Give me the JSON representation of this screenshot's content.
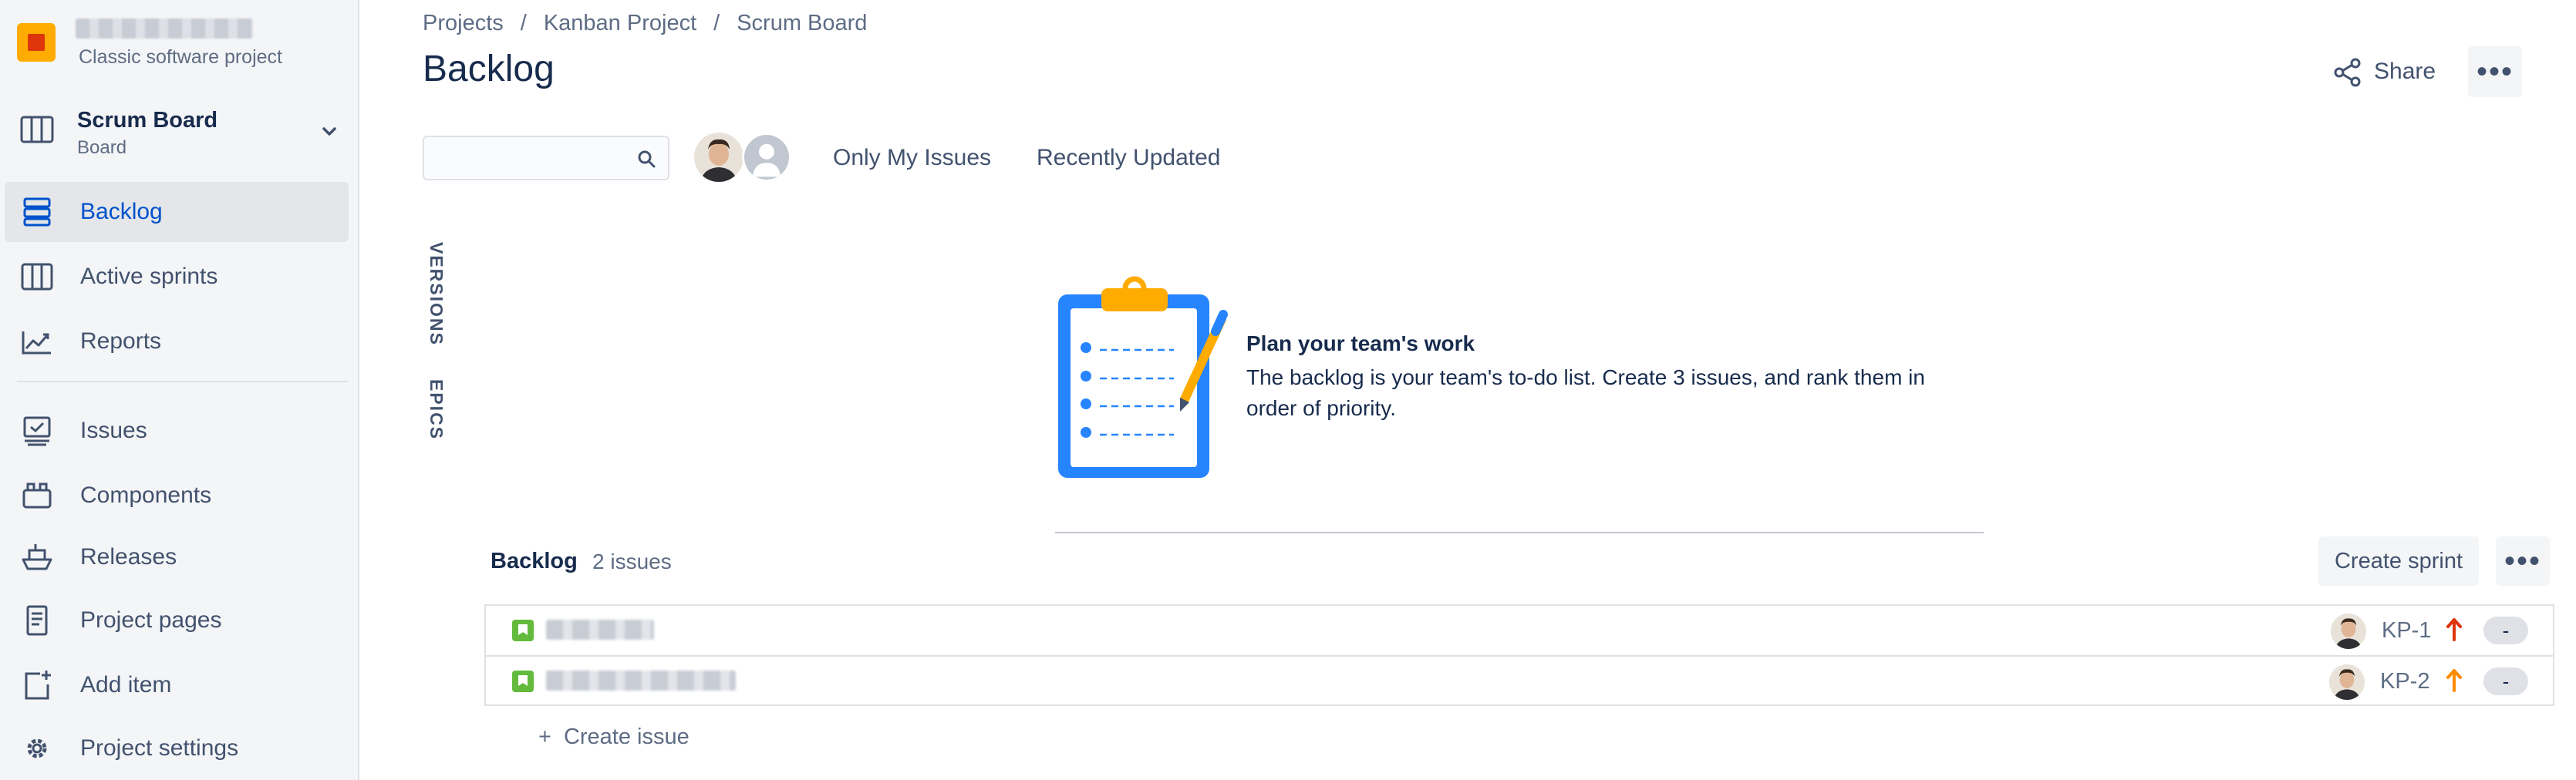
{
  "sidebar": {
    "project_type": "Classic software project",
    "board": {
      "title": "Scrum Board",
      "subtitle": "Board"
    },
    "nav_items": [
      {
        "label": "Backlog",
        "icon": "backlog-icon",
        "active": true
      },
      {
        "label": "Active sprints",
        "icon": "columns-icon",
        "active": false
      },
      {
        "label": "Reports",
        "icon": "chart-line-icon",
        "active": false
      },
      {
        "label": "Issues",
        "icon": "issues-icon",
        "active": false
      },
      {
        "label": "Components",
        "icon": "component-icon",
        "active": false
      },
      {
        "label": "Releases",
        "icon": "ship-icon",
        "active": false
      },
      {
        "label": "Project pages",
        "icon": "page-icon",
        "active": false
      },
      {
        "label": "Add item",
        "icon": "add-item-icon",
        "active": false
      },
      {
        "label": "Project settings",
        "icon": "gear-icon",
        "active": false
      }
    ]
  },
  "header": {
    "breadcrumbs": [
      "Projects",
      "Kanban Project",
      "Scrum Board"
    ],
    "separator": "/",
    "title": "Backlog",
    "share_label": "Share"
  },
  "filters": {
    "only_my_issues": "Only My Issues",
    "recently_updated": "Recently Updated"
  },
  "side_tabs": {
    "versions": "VERSIONS",
    "epics": "EPICS"
  },
  "empty_state": {
    "title": "Plan your team's work",
    "text": "The backlog is your team's to-do list. Create 3 issues, and rank them in order of priority."
  },
  "backlog": {
    "title": "Backlog",
    "count": "2 issues",
    "create_sprint": "Create sprint",
    "create_issue": "Create issue",
    "issues": [
      {
        "key": "KP-1",
        "priority": "high",
        "estimate": "-"
      },
      {
        "key": "KP-2",
        "priority": "medium",
        "estimate": "-"
      }
    ]
  },
  "colors": {
    "accent": "#0052cc",
    "priority_high": "#de350b",
    "priority_medium": "#ff8b00",
    "story": "#63ba3c",
    "project_logo": "#ffab00"
  }
}
